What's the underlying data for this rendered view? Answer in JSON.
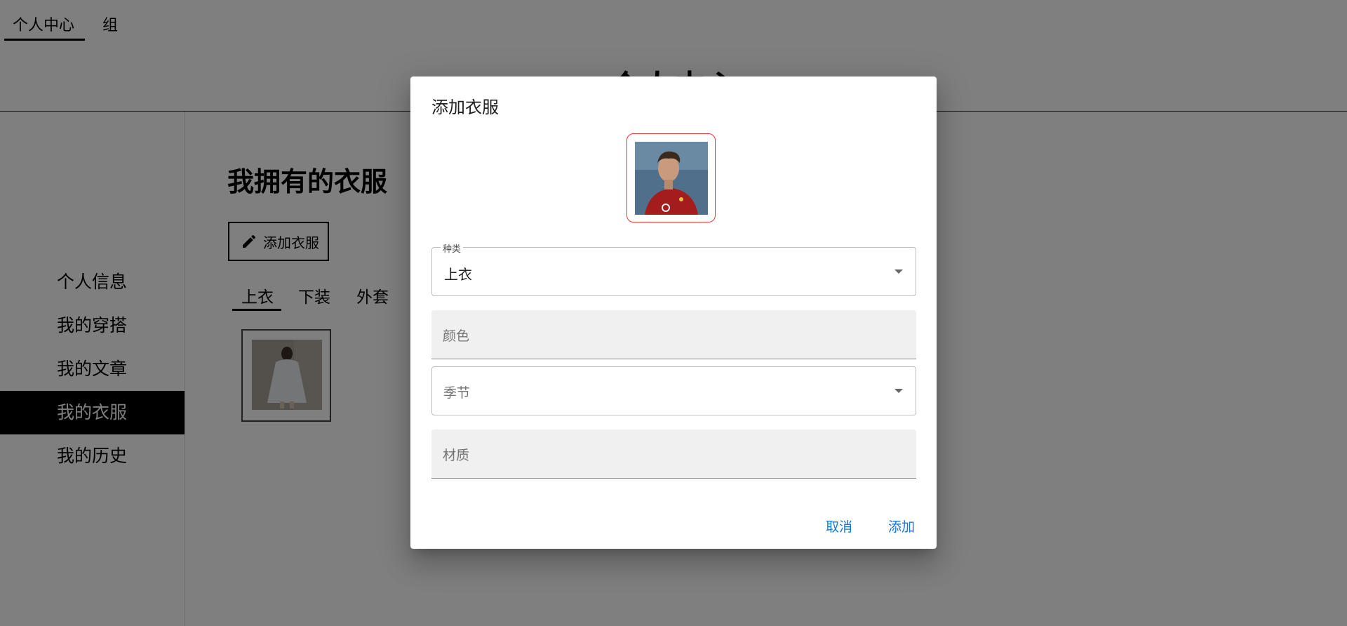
{
  "topnav": {
    "tabs": [
      {
        "label": "个人中心"
      },
      {
        "label": "组"
      }
    ]
  },
  "header": {
    "title": "个人中心"
  },
  "sidebar": {
    "items": [
      {
        "label": "个人信息"
      },
      {
        "label": "我的穿搭"
      },
      {
        "label": "我的文章"
      },
      {
        "label": "我的衣服"
      },
      {
        "label": "我的历史"
      }
    ],
    "active_index": 3
  },
  "main": {
    "title": "我拥有的衣服",
    "add_button_label": "添加衣服",
    "category_tabs": [
      {
        "label": "上衣"
      },
      {
        "label": "下装"
      },
      {
        "label": "外套"
      }
    ]
  },
  "dialog": {
    "title": "添加衣服",
    "fields": {
      "category": {
        "legend": "种类",
        "value": "上衣"
      },
      "color": {
        "placeholder": "颜色"
      },
      "season": {
        "placeholder": "季节"
      },
      "material": {
        "placeholder": "材质"
      }
    },
    "cancel_label": "取消",
    "add_label": "添加"
  },
  "colors": {
    "accent": "#1976d2",
    "avatar_border": "#e53935",
    "overlay": "rgba(0,0,0,0.5)",
    "active_sidebar": "#000000"
  },
  "icons": {
    "add_button": "pencil-icon",
    "select_caret": "caret-down-icon"
  }
}
